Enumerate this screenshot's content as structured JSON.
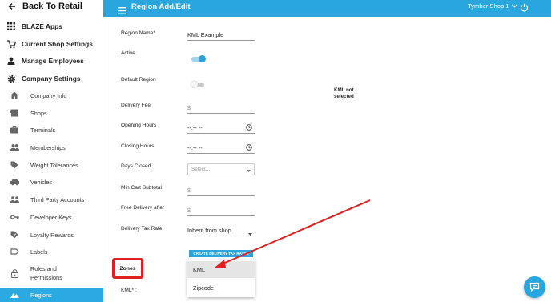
{
  "sidebar": {
    "back_label": "Back To Retail",
    "top_items": [
      {
        "label": "BLAZE Apps",
        "icon": "apps-grid-icon"
      },
      {
        "label": "Current Shop Settings",
        "icon": "cart-icon"
      },
      {
        "label": "Manage Employees",
        "icon": "person-icon"
      },
      {
        "label": "Company Settings",
        "icon": "gear-icon"
      }
    ],
    "sub_items": [
      {
        "label": "Company Info",
        "icon": "home-icon"
      },
      {
        "label": "Shops",
        "icon": "store-icon"
      },
      {
        "label": "Terminals",
        "icon": "briefcase-icon"
      },
      {
        "label": "Memberships",
        "icon": "people-icon"
      },
      {
        "label": "Weight Tolerances",
        "icon": "tag-icon"
      },
      {
        "label": "Vehicles",
        "icon": "car-icon"
      },
      {
        "label": "Third Party Accounts",
        "icon": "accounts-icon"
      },
      {
        "label": "Developer Keys",
        "icon": "key-icon"
      },
      {
        "label": "Loyalty Rewards",
        "icon": "loyalty-tag-icon"
      },
      {
        "label": "Labels",
        "icon": "label-icon"
      },
      {
        "label_line1": "Roles and",
        "label_line2": "Permissions",
        "icon": "lock-icon"
      },
      {
        "label": "Regions",
        "icon": "terrain-icon"
      }
    ]
  },
  "header": {
    "title": "Region Add/Edit",
    "shop": "Tymber Shop 1"
  },
  "form": {
    "region_name_label": "Region Name*",
    "region_name_value": "KML Example",
    "active_label": "Active",
    "active_on": true,
    "default_region_label": "Default Region",
    "default_region_on": false,
    "delivery_fee_label": "Delivery Fee",
    "delivery_fee_prefix": "$",
    "opening_hours_label": "Opening Hours",
    "opening_hours_value": "--:-- --",
    "closing_hours_label": "Closing Hours",
    "closing_hours_value": "--:-- --",
    "days_closed_label": "Days Closed",
    "days_closed_placeholder": "Select...",
    "min_cart_label": "Min Cart Subtotal",
    "min_cart_prefix": "$",
    "free_delivery_label": "Free Delivery after",
    "free_delivery_prefix": "$",
    "delivery_tax_label": "Delivery Tax Rate",
    "delivery_tax_value": "Inherit from shop",
    "create_tax_button": "CREATE DELIVERY TAX RATES",
    "zones_label": "Zones",
    "kml_label": "KML* :",
    "kml_note_line1": "KML not",
    "kml_note_line2": "selected",
    "zone_options": [
      "KML",
      "Zipcode"
    ],
    "zone_highlighted": "KML"
  },
  "colors": {
    "accent": "#2aa6df",
    "annotation_red": "#e02020"
  }
}
